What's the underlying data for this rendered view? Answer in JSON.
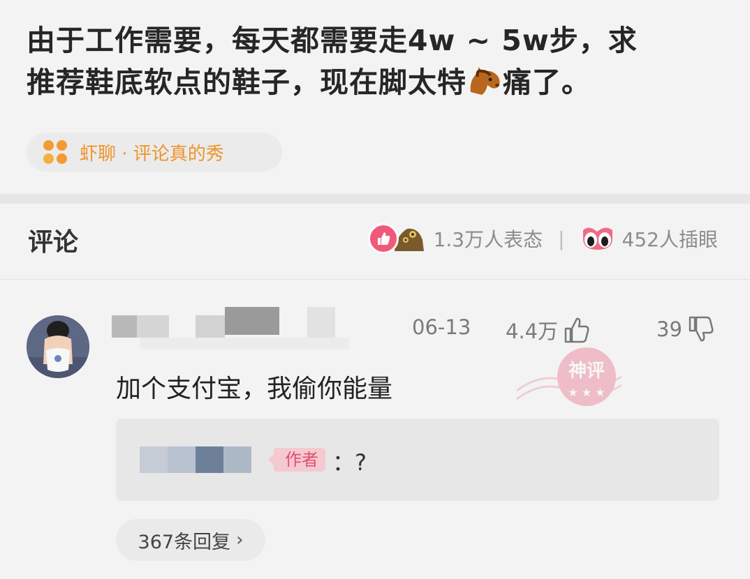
{
  "post": {
    "text_line1": "由于工作需要，每天都需要走4w ~ 5w步，求",
    "text_line2_a": "推荐鞋底软点的鞋子，现在脚太特",
    "text_line2_b": "痛了。",
    "inline_emoji": "horse-face-emoji"
  },
  "topic": {
    "label": "虾聊 · 评论真的秀",
    "icon": "four-dots-icon",
    "color": "#f0932a"
  },
  "comments_header": {
    "title": "评论",
    "reactions_count": "1.3万人表态",
    "separator": "|",
    "eyes_count": "452人插眼"
  },
  "comment": {
    "date": "06-13",
    "likes": "4.4万",
    "dislikes": "39",
    "body": "加个支付宝，我偷你能量",
    "stamp_text": "神评"
  },
  "reply": {
    "author_tag": "作者",
    "text": "：?"
  },
  "more_replies": {
    "label": "367条回复",
    "chevron": "›"
  },
  "colors": {
    "background": "#f3f3f3",
    "accent_orange": "#f0932a",
    "like_pink": "#ef5a7a",
    "author_tag_bg": "#f4c9d0",
    "author_tag_text": "#e2506e"
  }
}
